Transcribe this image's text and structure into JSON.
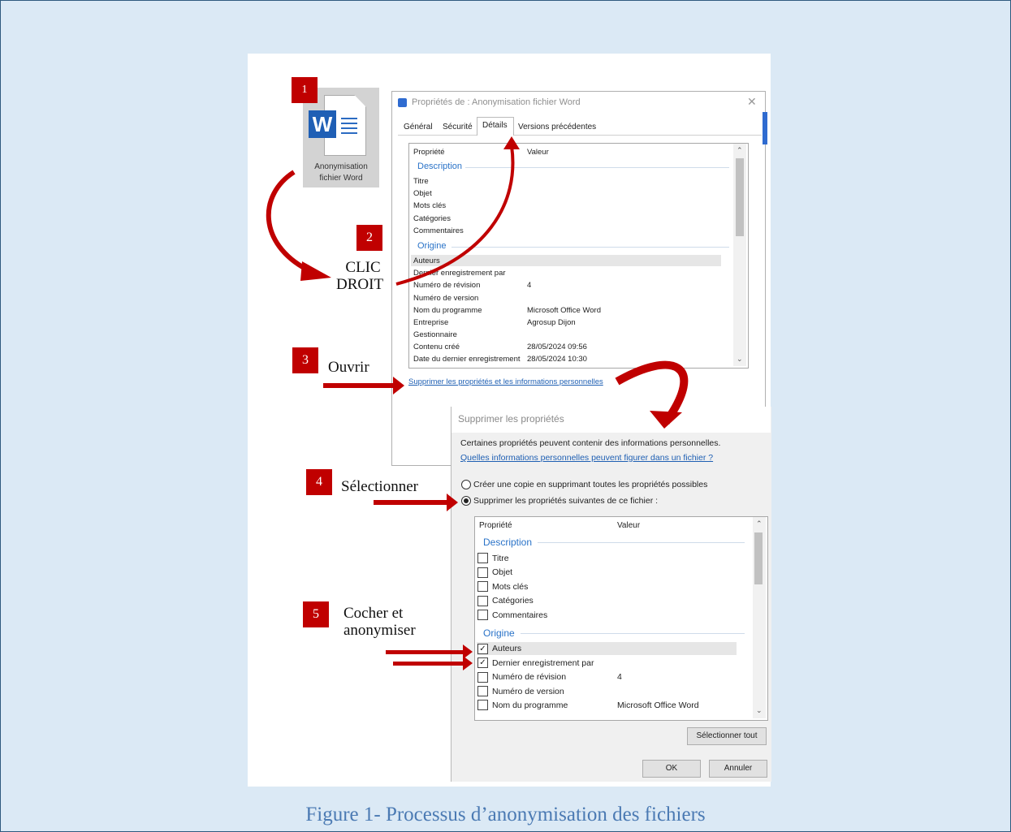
{
  "caption": "Figure 1- Processus d’anonymisation des fichiers",
  "file_icon": {
    "letter": "W",
    "label_line1": "Anonymisation",
    "label_line2": "fichier Word"
  },
  "properties_window": {
    "title": "Propriétés de : Anonymisation fichier Word",
    "tabs": [
      "Général",
      "Sécurité",
      "Détails",
      "Versions précédentes"
    ],
    "active_tab": "Détails",
    "col_property": "Propriété",
    "col_value": "Valeur",
    "group_description": "Description",
    "description_rows": [
      "Titre",
      "Objet",
      "Mots clés",
      "Catégories",
      "Commentaires"
    ],
    "group_origin": "Origine",
    "origin_rows": [
      {
        "name": "Auteurs",
        "value": ""
      },
      {
        "name": "Dernier enregistrement par",
        "value": ""
      },
      {
        "name": "Numéro de révision",
        "value": "4"
      },
      {
        "name": "Numéro de version",
        "value": ""
      },
      {
        "name": "Nom du programme",
        "value": "Microsoft Office Word"
      },
      {
        "name": "Entreprise",
        "value": "Agrosup Dijon"
      },
      {
        "name": "Gestionnaire",
        "value": ""
      },
      {
        "name": "Contenu créé",
        "value": "28/05/2024 09:56"
      },
      {
        "name": "Date du dernier enregistrement",
        "value": "28/05/2024 10:30"
      }
    ],
    "remove_link": "Supprimer les propriétés et les informations personnelles"
  },
  "remove_dialog": {
    "title": "Supprimer les propriétés",
    "intro": "Certaines propriétés peuvent contenir des informations personnelles.",
    "help_link": "Quelles informations personnelles peuvent figurer dans un fichier ?",
    "option_copy": "Créer une copie en supprimant toutes les propriétés possibles",
    "option_remove": "Supprimer les propriétés suivantes de ce fichier :",
    "col_property": "Propriété",
    "col_value": "Valeur",
    "group_description": "Description",
    "description_rows": [
      "Titre",
      "Objet",
      "Mots clés",
      "Catégories",
      "Commentaires"
    ],
    "group_origin": "Origine",
    "origin_rows": [
      {
        "name": "Auteurs",
        "value": "",
        "checked": true
      },
      {
        "name": "Dernier enregistrement par",
        "value": "",
        "checked": true
      },
      {
        "name": "Numéro de révision",
        "value": "4",
        "checked": false
      },
      {
        "name": "Numéro de version",
        "value": "",
        "checked": false
      },
      {
        "name": "Nom du programme",
        "value": "Microsoft Office Word",
        "checked": false
      }
    ],
    "select_all": "Sélectionner tout",
    "ok": "OK",
    "cancel": "Annuler"
  },
  "steps": [
    {
      "number": "1"
    },
    {
      "number": "2",
      "label_line1": "CLIC",
      "label_line2": "DROIT"
    },
    {
      "number": "3",
      "label": "Ouvrir"
    },
    {
      "number": "4",
      "label": "Sélectionner"
    },
    {
      "number": "5",
      "label_line1": "Cocher et",
      "label_line2": "anonymiser"
    }
  ],
  "colors": {
    "step_red": "#c00000",
    "link_blue": "#1e5fb3",
    "caption_blue": "#4b7ab3",
    "background": "#dbe9f5"
  }
}
